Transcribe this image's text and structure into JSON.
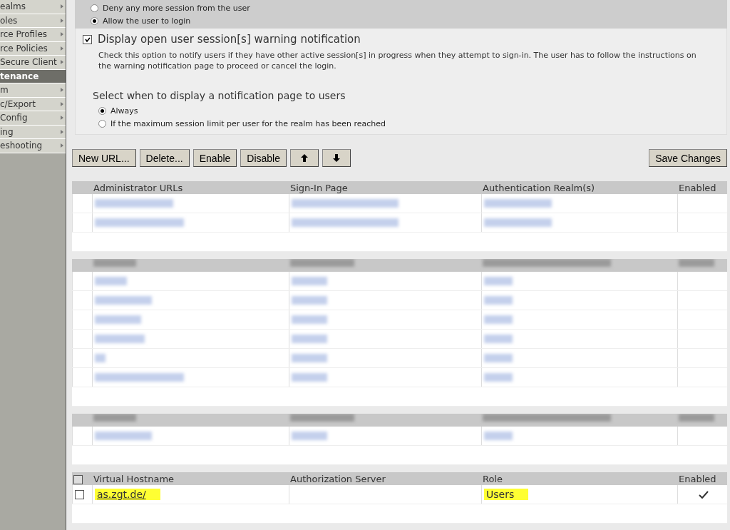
{
  "sidebar": {
    "items": [
      {
        "label": "ealms",
        "kind": "item"
      },
      {
        "label": "oles",
        "kind": "item"
      },
      {
        "label": "rce Profiles",
        "kind": "item"
      },
      {
        "label": "rce Policies",
        "kind": "item"
      },
      {
        "label": "Secure Client",
        "kind": "item"
      },
      {
        "label": "tenance",
        "kind": "header"
      },
      {
        "label": "m",
        "kind": "item"
      },
      {
        "label": "c/Export",
        "kind": "item"
      },
      {
        "label": "Config",
        "kind": "item"
      },
      {
        "label": "ing",
        "kind": "item"
      },
      {
        "label": "eshooting",
        "kind": "item"
      }
    ]
  },
  "session_options": [
    {
      "label": "Deny any more session from the user",
      "selected": false
    },
    {
      "label": "Allow the user to login",
      "selected": true
    }
  ],
  "warning": {
    "label": "Display open user session[s] warning notification",
    "checked": true,
    "description": "Check this option to notify users if they have other active session[s] in progress when they attempt to sign-in. The user has to follow the instructions on the warning notification page to proceed or cancel the login."
  },
  "notification": {
    "title": "Select when to display a notification page to users",
    "options": [
      {
        "label": "Always",
        "selected": true
      },
      {
        "label": "If the maximum session limit per user for the realm has been reached",
        "selected": false
      }
    ]
  },
  "toolbar": {
    "buttons": [
      {
        "label": "New URL...",
        "kind": "text"
      },
      {
        "label": "Delete...",
        "kind": "text"
      },
      {
        "label": "Enable",
        "kind": "text"
      },
      {
        "label": "Disable",
        "kind": "text"
      },
      {
        "kind": "up"
      },
      {
        "kind": "down"
      }
    ],
    "save": "Save Changes"
  },
  "admin_table": {
    "columns": [
      "Administrator URLs",
      "Sign-In Page",
      "Authentication Realm(s)",
      "Enabled"
    ]
  },
  "virtual_table": {
    "select_all_checked": false,
    "columns": [
      "Virtual Hostname",
      "Authorization Server",
      "Role",
      "Enabled"
    ],
    "rows": [
      {
        "hostname": "as.zgt.de/",
        "role": "Users",
        "enabled": true,
        "checked": false
      }
    ]
  }
}
